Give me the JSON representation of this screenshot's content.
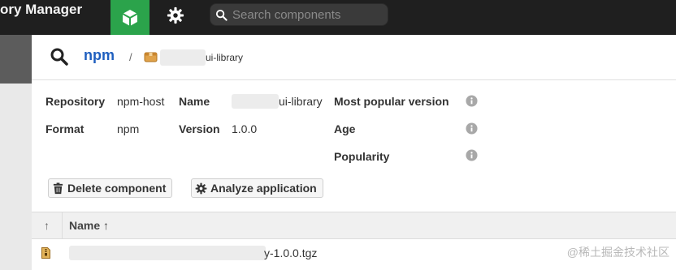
{
  "header": {
    "app_title": "ory Manager",
    "nav": {
      "browse_icon": "cube-icon",
      "admin_icon": "gear-icon"
    },
    "search": {
      "placeholder": "Search components",
      "value": ""
    }
  },
  "breadcrumb": {
    "root": "npm",
    "separator": "/",
    "component_suffix": "ui-library"
  },
  "details": {
    "repository_label": "Repository",
    "repository_value": "npm-host",
    "format_label": "Format",
    "format_value": "npm",
    "name_label": "Name",
    "name_value_suffix": "ui-library",
    "version_label": "Version",
    "version_value": "1.0.0",
    "popular_label": "Most popular version",
    "age_label": "Age",
    "popularity_label": "Popularity"
  },
  "actions": {
    "delete_label": "Delete component",
    "analyze_label": "Analyze application"
  },
  "table": {
    "sort_col_header": "↑",
    "name_header": "Name ↑",
    "rows": [
      {
        "name_suffix": "y-1.0.0.tgz"
      }
    ]
  },
  "watermark": "@稀土掘金技术社区",
  "colors": {
    "accent_green": "#2ba34b",
    "link_blue": "#1f5fbf",
    "header_dark": "#1f1f1f"
  }
}
